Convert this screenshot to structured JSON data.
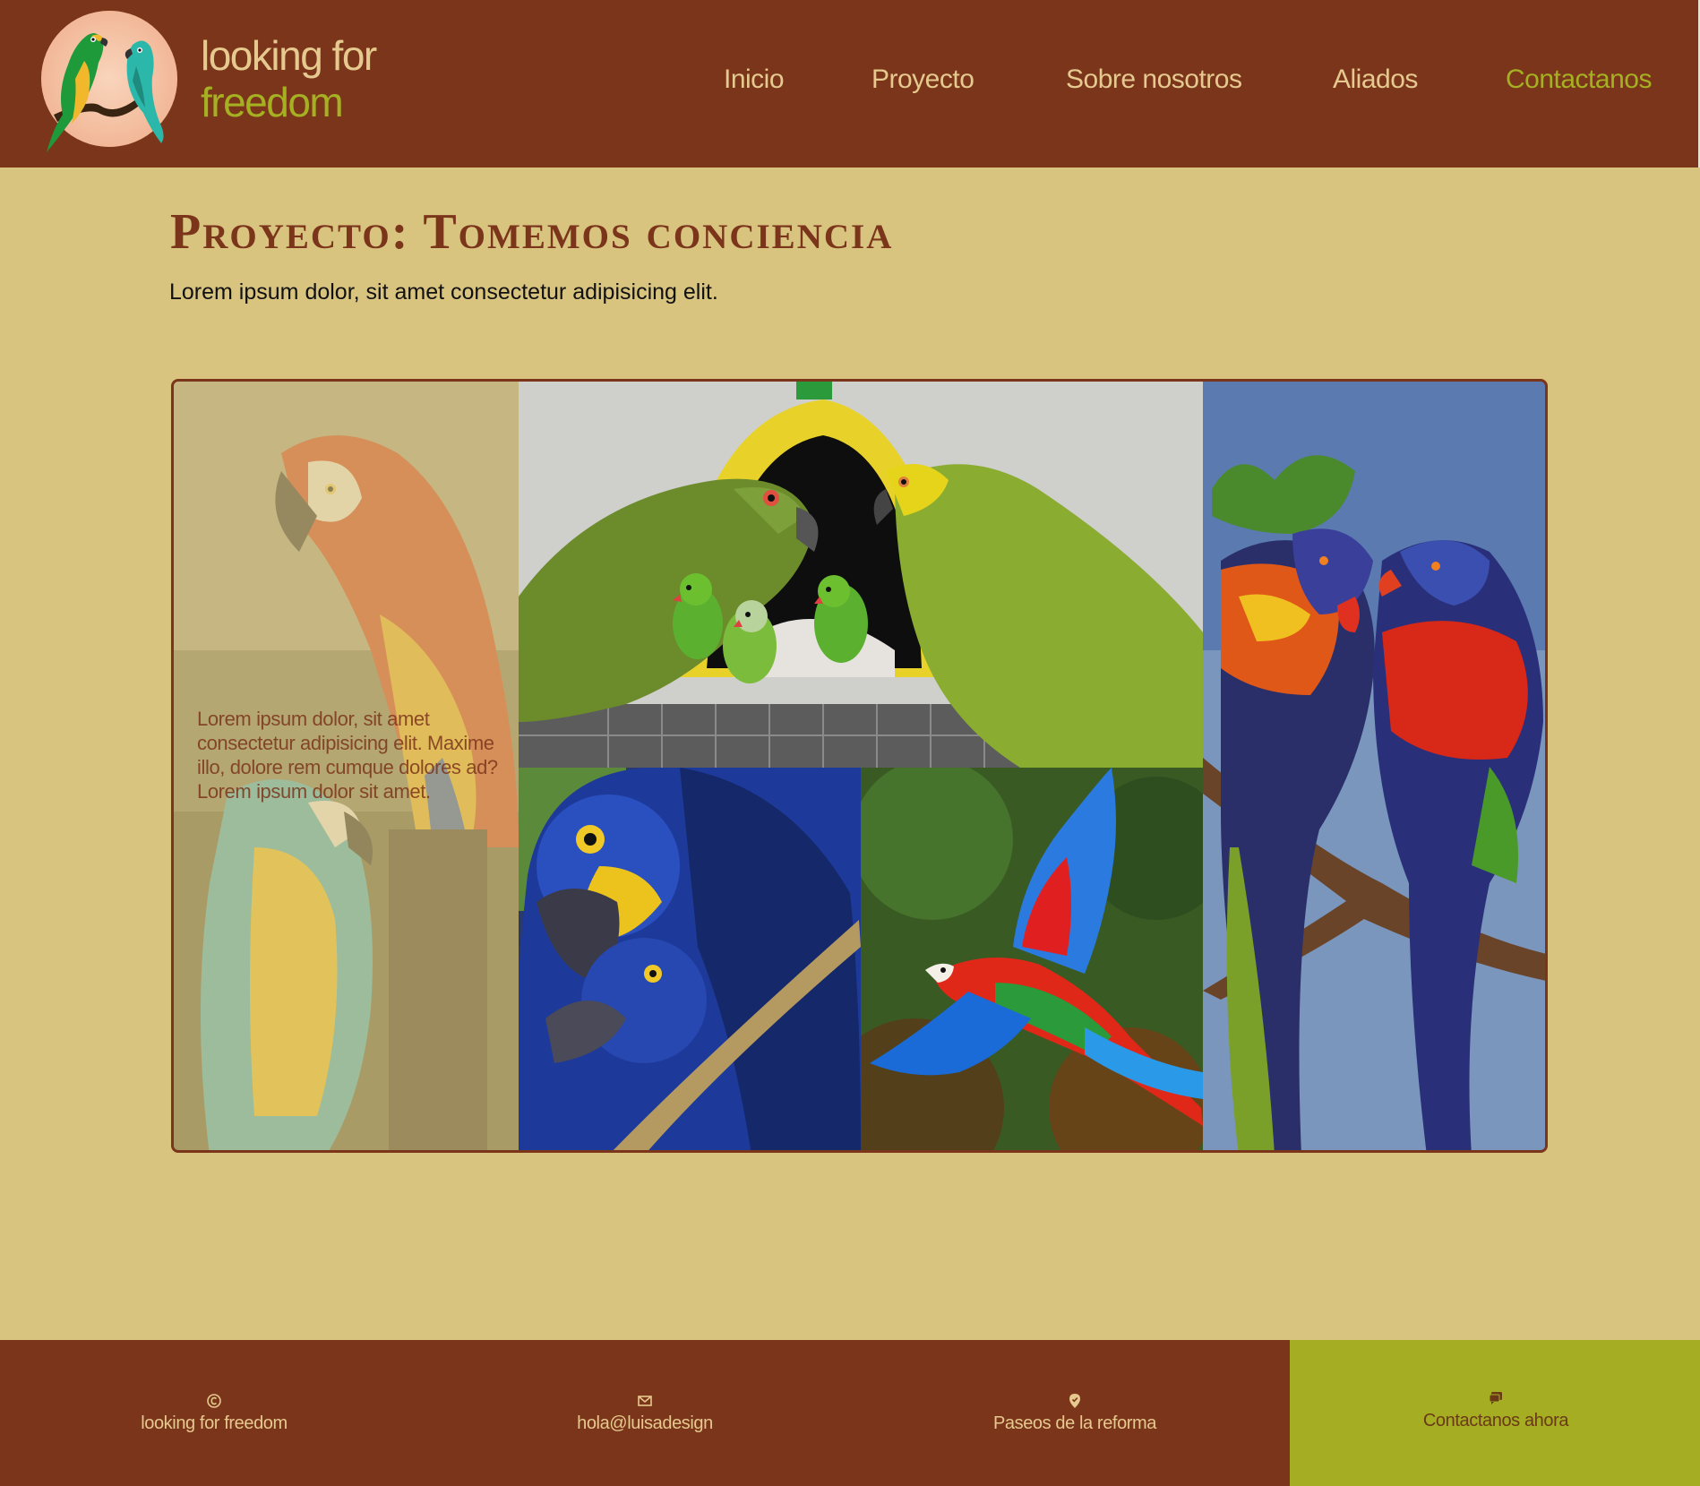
{
  "brand": {
    "line1": "looking for",
    "line2": "freedom"
  },
  "nav": {
    "items": [
      {
        "label": "Inicio"
      },
      {
        "label": "Proyecto"
      },
      {
        "label": "Sobre nosotros"
      },
      {
        "label": "Aliados"
      },
      {
        "label": "Contactanos",
        "active": true
      }
    ]
  },
  "main": {
    "title": "Proyecto: Tomemos conciencia",
    "subtitle": "Lorem ipsum dolor, sit amet consectetur adipisicing elit.",
    "overlay_text": "Lorem ipsum dolor, sit amet consectetur adipisicing elit. Maxime illo, dolore rem cumque dolores ad? Lorem ipsum dolor sit amet."
  },
  "gallery": {
    "images": [
      {
        "subject": "scarlet and blue-and-yellow macaws"
      },
      {
        "subject": "green amazon parrots with chicks"
      },
      {
        "subject": "rainbow lorikeets on branch"
      },
      {
        "subject": "hyacinth macaws"
      },
      {
        "subject": "red-and-green macaw in flight"
      }
    ]
  },
  "footer": {
    "brand": "looking for freedom",
    "email": "hola@luisadesign",
    "location": "Paseos de la reforma",
    "cta": "Contactanos ahora",
    "icons": [
      "copyright-icon",
      "mail-icon",
      "location-icon",
      "chat-icon"
    ]
  },
  "colors": {
    "header_bg": "#7b351b",
    "page_bg": "#d8c47f",
    "accent_green": "#a5b022",
    "nav_text": "#e6c98e",
    "cta_bg": "#a5ad22"
  }
}
